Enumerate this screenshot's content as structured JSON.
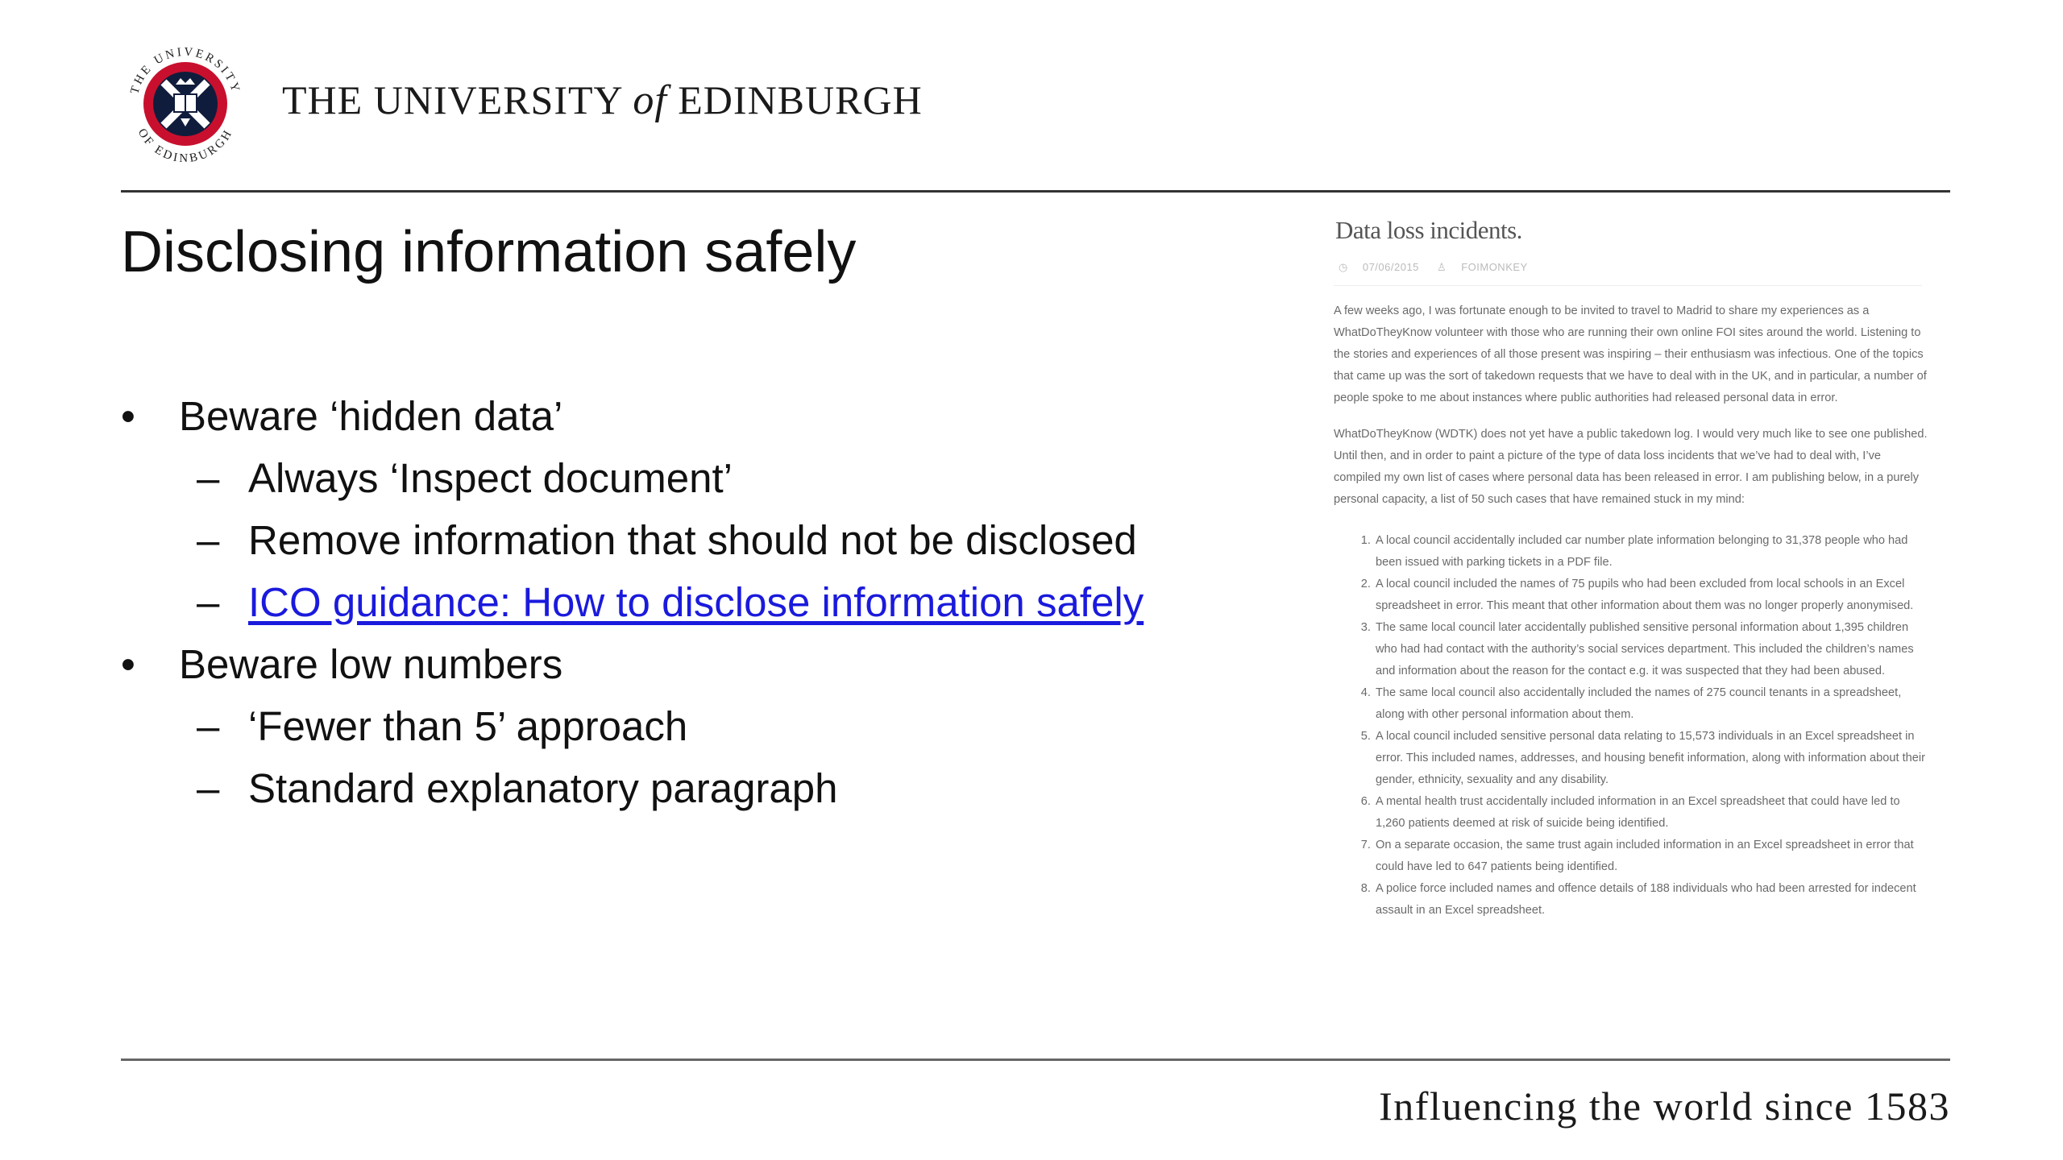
{
  "header": {
    "name_part1": "THE UNIVERSITY ",
    "name_of": "of",
    "name_part2": " EDINBURGH",
    "crest_text": "THE UNIVERSITY OF EDINBURGH"
  },
  "slide": {
    "title": "Disclosing information safely",
    "bullets": [
      {
        "text": "Beware ‘hidden data’",
        "subs": [
          "Always ‘Inspect document’",
          "Remove information that should not be disclosed",
          "ICO guidance: How to disclose information safely"
        ]
      },
      {
        "text": "Beware low numbers",
        "subs": [
          "‘Fewer than 5’ approach",
          "Standard explanatory paragraph"
        ]
      }
    ],
    "bullet_symbol": "•",
    "dash_symbol": "–"
  },
  "screenshot": {
    "title": "Data loss incidents.",
    "date": "07/06/2015",
    "author": "FOIMONKEY",
    "para1": "A few weeks ago, I was fortunate enough to be invited to travel to Madrid to share my experiences as a WhatDoTheyKnow volunteer with those who are running their own online FOI sites around the world. Listening to the stories and experiences of all those present was inspiring – their enthusiasm was infectious. One of the topics that came up was the sort of takedown requests that we have to deal with in the UK, and in particular, a number of people spoke to me about instances where public authorities had released personal data in error.",
    "para2": "WhatDoTheyKnow (WDTK) does not yet have a public takedown log. I would very much like to see one published. Until then, and in order to paint a picture of the type of data loss incidents that we’ve had to deal with, I’ve compiled my own list of cases where personal data has been released in error. I am publishing below, in a purely personal capacity, a list of 50 such cases that have remained stuck in my mind:",
    "items": [
      "A local council accidentally included car number plate information belonging to 31,378 people who had been issued with parking tickets in a PDF file.",
      "A local council included the names of 75 pupils who had been excluded from local schools in an Excel spreadsheet in error. This meant that other information about them was no longer properly anonymised.",
      "The same local council later accidentally published sensitive personal information about 1,395 children who had had contact with the authority’s social services department. This included the children’s names and information about the reason for the contact e.g. it was suspected that they had been abused.",
      "The same local council also accidentally included the names of 275 council tenants in a spreadsheet, along with other personal information about them.",
      "A local council included sensitive personal data relating to 15,573 individuals in an Excel spreadsheet in error. This included names, addresses, and housing benefit information, along with information about their gender, ethnicity, sexuality and any disability.",
      "A mental health trust accidentally included information in an Excel spreadsheet that could have led to 1,260 patients deemed at risk of suicide being identified.",
      "On a separate occasion, the same trust again included information in an Excel spreadsheet in error that could have led to 647 patients being identified.",
      "A police force included names and offence details of 188 individuals who had been arrested for indecent assault in an Excel spreadsheet."
    ]
  },
  "footer": {
    "tagline": "Influencing the world since 1583"
  },
  "colors": {
    "crest_red": "#c8102e",
    "crest_navy": "#101c3c",
    "link": "#1a1add",
    "rule": "#333333"
  }
}
